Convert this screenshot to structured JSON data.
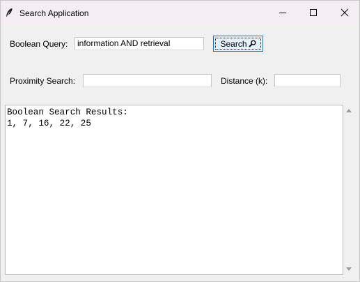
{
  "window": {
    "title": "Search Application",
    "app_icon": "feather-icon",
    "controls": {
      "minimize_icon": "minimize-icon",
      "maximize_icon": "maximize-icon",
      "close_icon": "close-icon"
    }
  },
  "boolean": {
    "label": "Boolean Query:",
    "value": "information AND retrieval"
  },
  "search_button": {
    "label": "Search",
    "icon": "magnifier-icon"
  },
  "proximity": {
    "label": "Proximity Search:",
    "value": ""
  },
  "distance": {
    "label": "Distance (k):",
    "value": ""
  },
  "results": {
    "lines": [
      "Boolean Search Results:",
      "1, 7, 16, 22, 25"
    ]
  },
  "colors": {
    "titlebar": "#f4eef4",
    "window_bg": "#f0f0f0",
    "button_bg": "#e5f1fb",
    "button_border": "#0078d7"
  }
}
